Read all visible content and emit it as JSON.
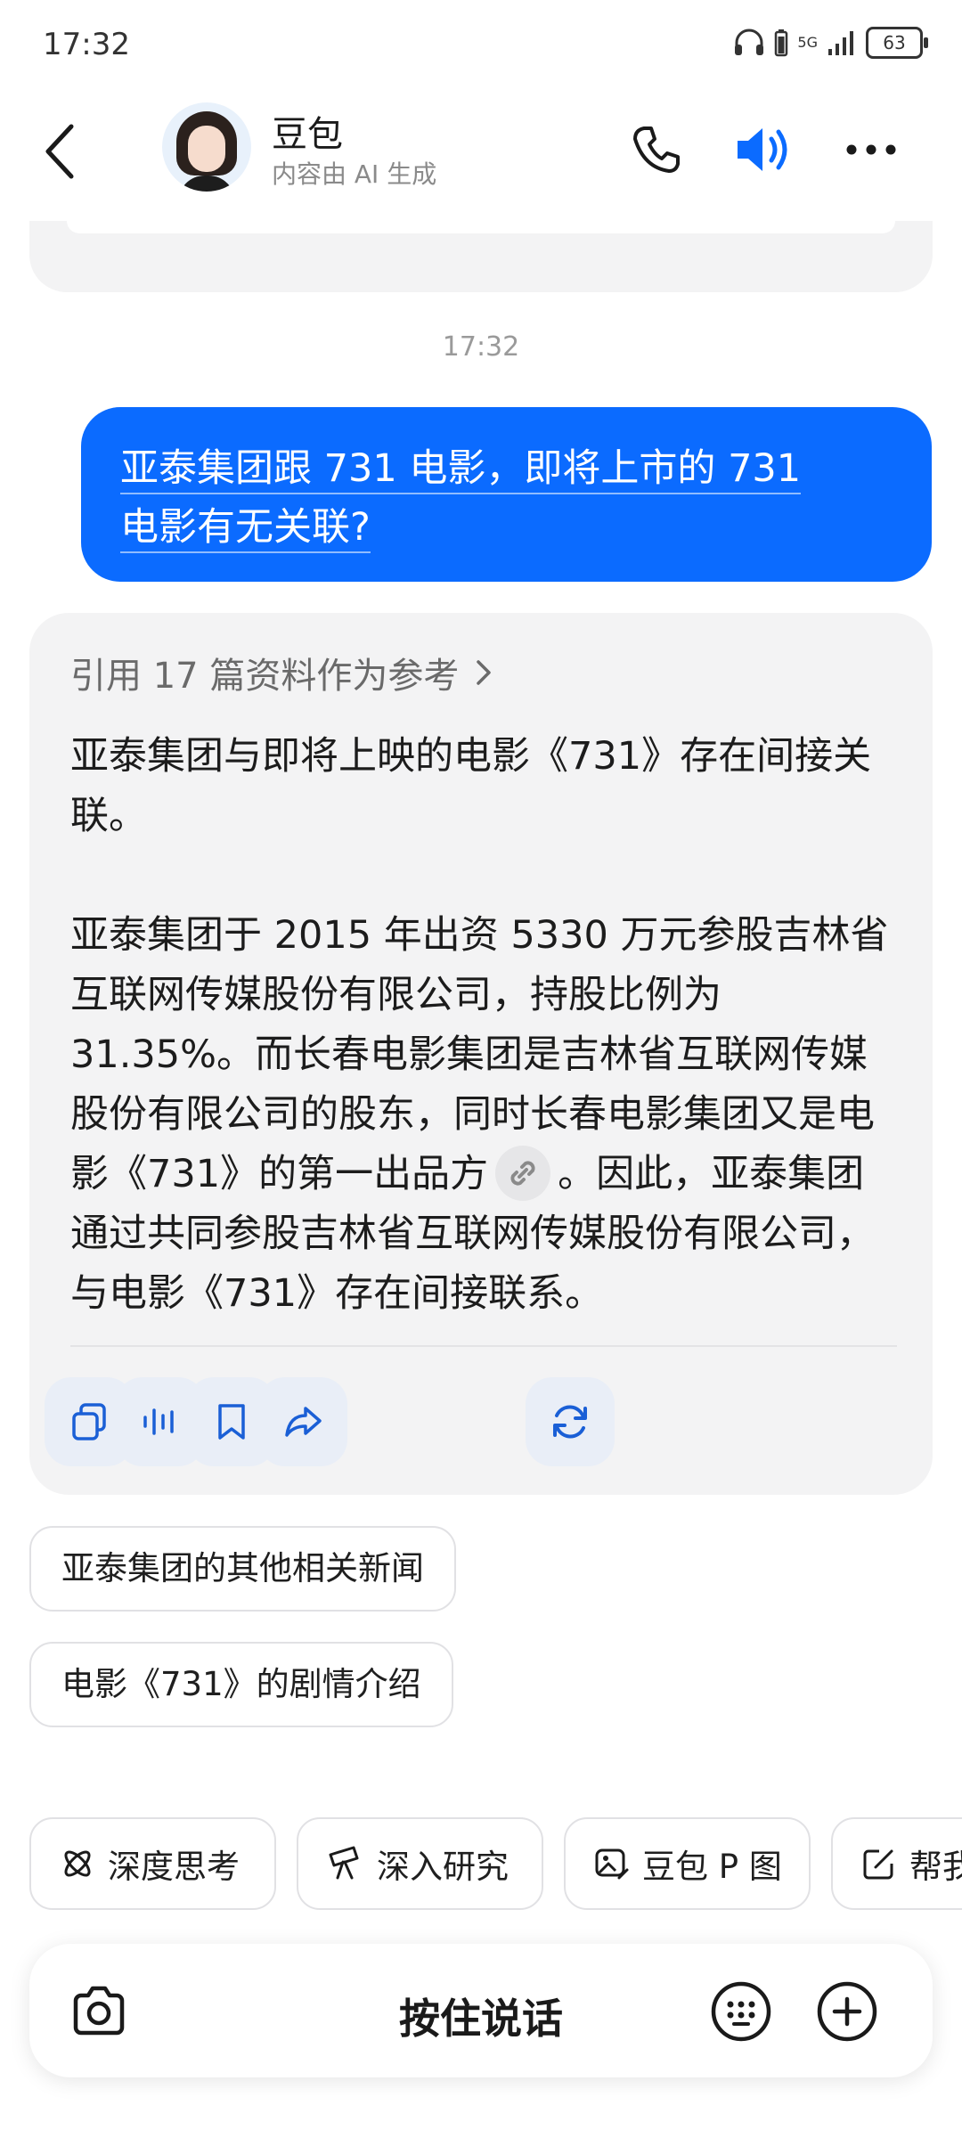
{
  "status": {
    "time": "17:32",
    "battery": "63",
    "network": "5G"
  },
  "header": {
    "title": "豆包",
    "subtitle": "内容由 AI 生成"
  },
  "chat": {
    "timestamp": "17:32",
    "user_message": {
      "line1": "亚泰集团跟 731 电影，即将上市的 731",
      "line2": "电影有无关联?"
    },
    "answer": {
      "reference": "引用 17 篇资料作为参考",
      "para1": "亚泰集团与即将上映的电影《731》存在间接关联。",
      "para2_a": "亚泰集团于 2015 年出资 5330 万元参股吉林省互联网传媒股份有限公司，持股比例为 31.35%。而长春电影集团是吉林省互联网传媒股份有限公司的股东，同时长春电影集团又是电影《731》的第一出品方",
      "para2_b": "。因此，亚泰集团通过共同参股吉林省互联网传媒股份有限公司，与电影《731》存在间接联系。"
    },
    "suggestions": [
      "亚泰集团的其他相关新闻",
      "电影《731》的剧情介绍"
    ]
  },
  "tools": [
    {
      "label": "深度思考",
      "icon": "atom-icon"
    },
    {
      "label": "深入研究",
      "icon": "telescope-icon"
    },
    {
      "label": "豆包 P 图",
      "icon": "image-edit-icon"
    },
    {
      "label": "帮我写作",
      "icon": "pen-square-icon"
    }
  ],
  "input": {
    "label": "按住说话"
  }
}
